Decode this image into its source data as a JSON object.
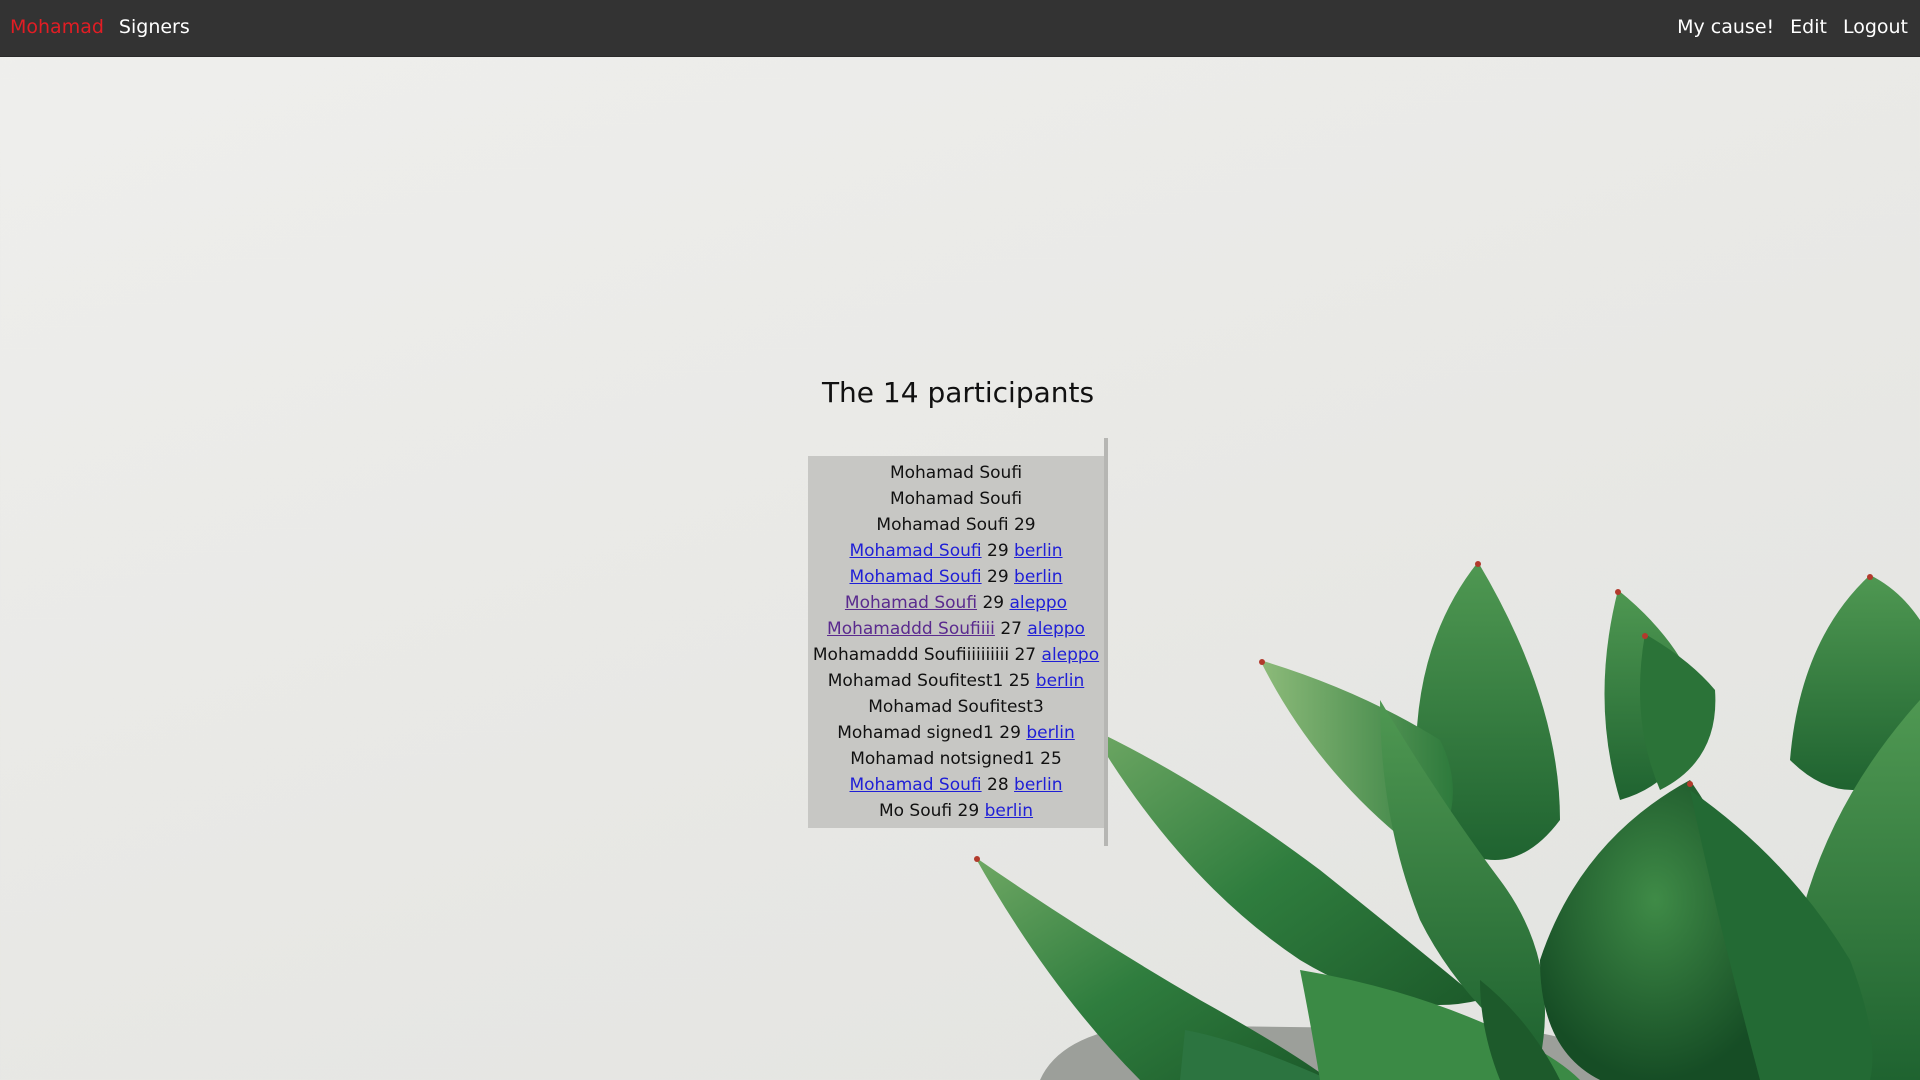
{
  "nav": {
    "brand": "Mohamad",
    "signers": "Signers",
    "my_cause": "My cause!",
    "edit": "Edit",
    "logout": "Logout"
  },
  "colors": {
    "nav_bg": "#333333",
    "brand": "#e21d24",
    "link": "#1f1fd6",
    "visited_link": "#5a2a8e",
    "panel_bg": "#c7c7c4"
  },
  "main": {
    "title": "The 14 participants",
    "participants": [
      {
        "name": "Mohamad Soufi",
        "name_link": false,
        "name_visited": false,
        "age": "",
        "city": "",
        "city_visited": false
      },
      {
        "name": "Mohamad Soufi",
        "name_link": false,
        "name_visited": false,
        "age": "",
        "city": "",
        "city_visited": false
      },
      {
        "name": "Mohamad Soufi",
        "name_link": false,
        "name_visited": false,
        "age": "29",
        "city": "",
        "city_visited": false
      },
      {
        "name": "Mohamad Soufi",
        "name_link": true,
        "name_visited": false,
        "age": "29",
        "city": "berlin",
        "city_visited": false
      },
      {
        "name": "Mohamad Soufi",
        "name_link": true,
        "name_visited": false,
        "age": "29",
        "city": "berlin",
        "city_visited": false
      },
      {
        "name": "Mohamad Soufi",
        "name_link": true,
        "name_visited": true,
        "age": "29",
        "city": "aleppo",
        "city_visited": false
      },
      {
        "name": "Mohamaddd Soufiiii",
        "name_link": true,
        "name_visited": true,
        "age": "27",
        "city": "aleppo",
        "city_visited": false
      },
      {
        "name": "Mohamaddd Soufiiiiiiiiii",
        "name_link": false,
        "name_visited": false,
        "age": "27",
        "city": "aleppo",
        "city_visited": false
      },
      {
        "name": "Mohamad Soufitest1",
        "name_link": false,
        "name_visited": false,
        "age": "25",
        "city": "berlin",
        "city_visited": false
      },
      {
        "name": "Mohamad Soufitest3",
        "name_link": false,
        "name_visited": false,
        "age": "",
        "city": "",
        "city_visited": false
      },
      {
        "name": "Mohamad signed1",
        "name_link": false,
        "name_visited": false,
        "age": "29",
        "city": "berlin",
        "city_visited": false
      },
      {
        "name": "Mohamad notsigned1",
        "name_link": false,
        "name_visited": false,
        "age": "25",
        "city": "",
        "city_visited": false
      },
      {
        "name": "Mohamad Soufi",
        "name_link": true,
        "name_visited": false,
        "age": "28",
        "city": "berlin",
        "city_visited": false
      },
      {
        "name": "Mo Soufi",
        "name_link": false,
        "name_visited": false,
        "age": "29",
        "city": "berlin",
        "city_visited": false
      }
    ]
  }
}
